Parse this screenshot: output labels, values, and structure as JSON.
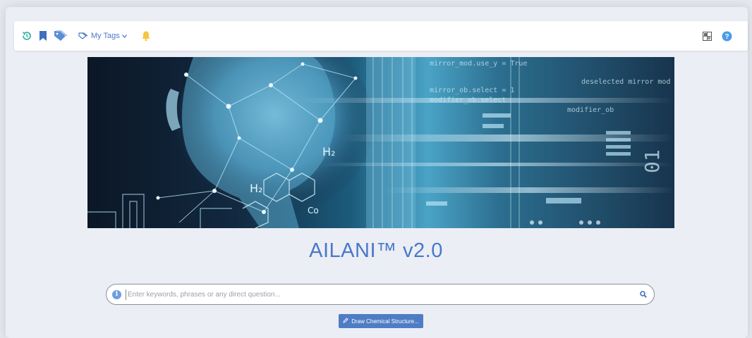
{
  "toolbar": {
    "icons": [
      "history-icon",
      "bookmark-icon",
      "tags-icon",
      "notification-bell-icon",
      "layout-toggle-icon",
      "help-icon"
    ],
    "my_tags_label": "My Tags",
    "help_glyph": "?"
  },
  "banner": {
    "code_lines": [
      "mirror_mod.use_y = True",
      "mirror_ob.select = 1",
      "deselected mirror mod",
      "modifier_ob.select",
      "modifier_ob"
    ],
    "formula_labels": [
      "H₂",
      "H₂",
      "Co"
    ],
    "binary_digits": "01"
  },
  "brand_title": "AILANI™ v2.0",
  "search": {
    "placeholder": "Enter keywords, phrases or any direct question...",
    "value": "",
    "info_glyph": "i"
  },
  "draw_button_label": "Draw Chemical Structure...",
  "colors": {
    "accent": "#4a78c9",
    "button": "#4e7dc5",
    "bell": "#f5c542",
    "history": "#3fb1a8",
    "background": "#eceef5"
  }
}
